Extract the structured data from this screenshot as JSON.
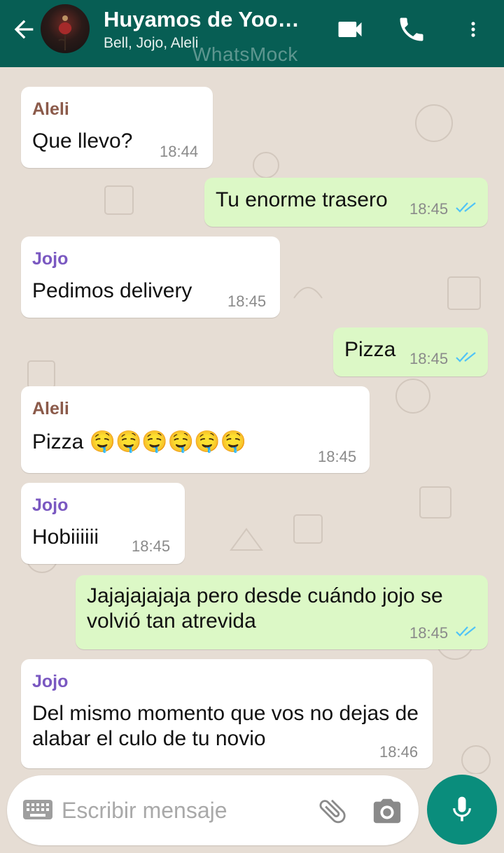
{
  "header": {
    "title": "Huyamos de Yoo…",
    "subtitle": "Bell, Jojo, Aleli",
    "watermark": "WhatsMock",
    "color": "#075e54"
  },
  "messages": [
    {
      "direction": "in",
      "sender": "Aleli",
      "text": "Que llevo?",
      "time": "18:44"
    },
    {
      "direction": "out",
      "text": "Tu enorme trasero",
      "time": "18:45",
      "status": "read"
    },
    {
      "direction": "in",
      "sender": "Jojo",
      "text": "Pedimos delivery",
      "time": "18:45"
    },
    {
      "direction": "out",
      "text": "Pizza",
      "time": "18:45",
      "status": "read"
    },
    {
      "direction": "in",
      "sender": "Aleli",
      "text": "Pizza 🤤🤤🤤🤤🤤🤤",
      "time": "18:45"
    },
    {
      "direction": "in",
      "sender": "Jojo",
      "text": "Hobiiiiii",
      "time": "18:45"
    },
    {
      "direction": "out",
      "text": "Jajajajajaja pero desde cuándo jojo se volvió tan atrevida",
      "time": "18:45",
      "status": "read"
    },
    {
      "direction": "in",
      "sender": "Jojo",
      "text": "Del mismo momento que vos no dejas de alabar el culo de tu novio",
      "time": "18:46"
    }
  ],
  "composer": {
    "placeholder": "Escribir mensaje"
  },
  "colors": {
    "chat_bg": "#e6ddd4",
    "incoming": "#ffffff",
    "outgoing": "#dcf8c6",
    "read_ticks": "#4fc3f7",
    "mic_button": "#0a8d7c"
  },
  "icons": [
    "back-arrow-icon",
    "video-call-icon",
    "phone-icon",
    "more-vert-icon",
    "keyboard-icon",
    "attach-icon",
    "camera-icon",
    "mic-icon"
  ]
}
